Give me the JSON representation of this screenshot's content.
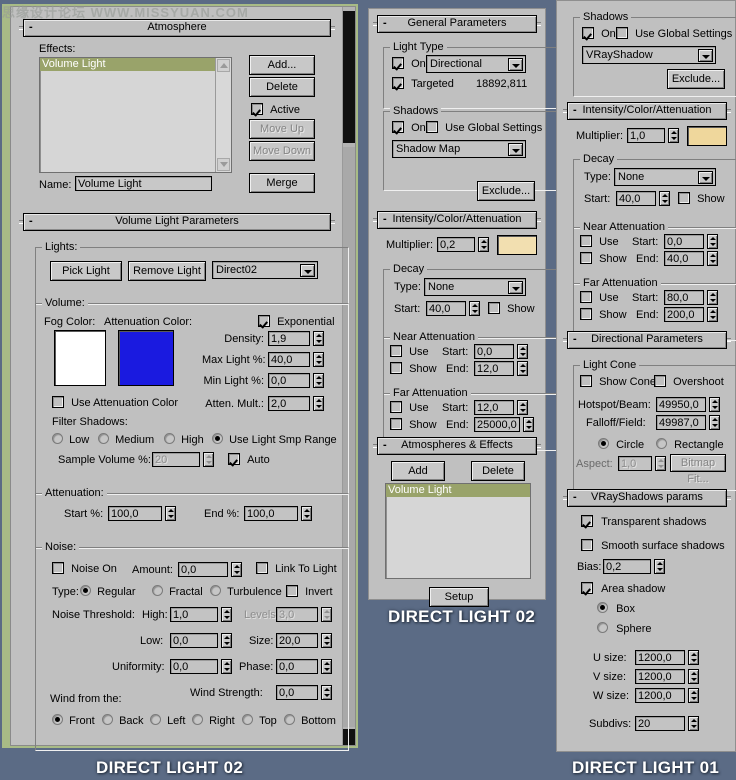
{
  "watermark": "思缘设计论坛  WWW.MISSYUAN.COM",
  "captions": {
    "left": "DIRECT LIGHT 02",
    "middle": "DIRECT LIGHT 02",
    "right": "DIRECT LIGHT 01"
  },
  "colors": {
    "desktop": "#5b6b85",
    "panel": "#c0c0c0",
    "selection": "#99a36a",
    "fog_color": "#ffffff",
    "attenuation_color": "#1a1ae0",
    "light_color_mid": "#f2dfb0",
    "light_color_right": "#efd79c",
    "panel_border_green": "#a8bb86"
  },
  "left_panel": {
    "atmosphere": {
      "title": "Atmosphere",
      "effects_label": "Effects:",
      "effects_items": [
        "Volume Light"
      ],
      "buttons": {
        "add": "Add...",
        "delete": "Delete",
        "move_up": "Move Up",
        "move_down": "Move Down",
        "merge": "Merge"
      },
      "active_label": "Active",
      "active_checked": true,
      "name_label": "Name:",
      "name_value": "Volume Light"
    },
    "volume_light": {
      "title": "Volume Light Parameters",
      "lights_group": "Lights:",
      "pick_light": "Pick Light",
      "remove_light": "Remove Light",
      "light_selected": "Direct02",
      "volume_group": "Volume:",
      "fog_color_label": "Fog Color:",
      "attenuation_color_label": "Attenuation Color:",
      "exponential_label": "Exponential",
      "exponential_checked": true,
      "density_label": "Density:",
      "density_value": "1,9",
      "max_light_label": "Max Light %:",
      "max_light_value": "40,0",
      "min_light_label": "Min Light %:",
      "min_light_value": "0,0",
      "use_attenuation_label": "Use Attenuation Color",
      "use_attenuation_checked": false,
      "atten_mult_label": "Atten. Mult.:",
      "atten_mult_value": "2,0",
      "filter_shadows_label": "Filter Shadows:",
      "filter_options": [
        "Low",
        "Medium",
        "High",
        "Use Light Smp Range"
      ],
      "filter_selected": 3,
      "sample_volume_label": "Sample Volume %:",
      "sample_volume_value": "20",
      "sample_volume_disabled": true,
      "auto_label": "Auto",
      "auto_checked": true,
      "attenuation_group": "Attenuation:",
      "att_start_label": "Start %:",
      "att_start_value": "100,0",
      "att_end_label": "End %:",
      "att_end_value": "100,0",
      "noise_group": "Noise:",
      "noise_on_label": "Noise On",
      "noise_on_checked": false,
      "amount_label": "Amount:",
      "amount_value": "0,0",
      "link_to_light_label": "Link To Light",
      "link_to_light_checked": false,
      "type_label": "Type:",
      "noise_types": [
        "Regular",
        "Fractal",
        "Turbulence"
      ],
      "noise_type_selected": 0,
      "invert_label": "Invert",
      "invert_checked": false,
      "noise_threshold_label": "Noise Threshold:",
      "high_label": "High:",
      "high_value": "1,0",
      "levels_label": "Levels:",
      "levels_value": "3,0",
      "levels_disabled": true,
      "low_label": "Low:",
      "low_value": "0,0",
      "size_label": "Size:",
      "size_value": "20,0",
      "uniformity_label": "Uniformity:",
      "uniformity_value": "0,0",
      "phase_label": "Phase:",
      "phase_value": "0,0",
      "wind_from_label": "Wind from the:",
      "wind_strength_label": "Wind Strength:",
      "wind_strength_value": "0,0",
      "wind_dirs": [
        "Front",
        "Back",
        "Left",
        "Right",
        "Top",
        "Bottom"
      ],
      "wind_dir_selected": 0
    }
  },
  "middle_panel": {
    "general": {
      "title": "General Parameters",
      "light_type_group": "Light Type",
      "on_label": "On",
      "on_checked": true,
      "light_type_value": "Directional",
      "targeted_label": "Targeted",
      "targeted_checked": true,
      "target_distance": "18892,811",
      "shadows_group": "Shadows",
      "shadow_on_label": "On",
      "shadow_on_checked": true,
      "use_global_label": "Use Global Settings",
      "use_global_checked": false,
      "shadow_type_value": "Shadow Map",
      "exclude_label": "Exclude..."
    },
    "intensity": {
      "title": "Intensity/Color/Attenuation",
      "multiplier_label": "Multiplier:",
      "multiplier_value": "0,2",
      "decay_group": "Decay",
      "decay_type_label": "Type:",
      "decay_type_value": "None",
      "decay_start_label": "Start:",
      "decay_start_value": "40,0",
      "decay_show_label": "Show",
      "decay_show_checked": false,
      "near_group": "Near Attenuation",
      "near_use_label": "Use",
      "near_use_checked": false,
      "near_show_label": "Show",
      "near_show_checked": false,
      "near_start_label": "Start:",
      "near_start_value": "0,0",
      "near_end_label": "End:",
      "near_end_value": "12,0",
      "far_group": "Far Attenuation",
      "far_use_label": "Use",
      "far_use_checked": false,
      "far_show_label": "Show",
      "far_show_checked": false,
      "far_start_label": "Start:",
      "far_start_value": "12,0",
      "far_end_label": "End:",
      "far_end_value": "25000,0"
    },
    "atmospheres": {
      "title": "Atmospheres & Effects",
      "add_label": "Add",
      "delete_label": "Delete",
      "items": [
        "Volume Light"
      ],
      "setup_label": "Setup"
    }
  },
  "right_panel": {
    "shadows": {
      "title": "Shadows",
      "on_label": "On",
      "on_checked": true,
      "use_global_label": "Use Global Settings",
      "use_global_checked": false,
      "shadow_type_value": "VRayShadow",
      "exclude_label": "Exclude..."
    },
    "intensity": {
      "title": "Intensity/Color/Attenuation",
      "multiplier_label": "Multiplier:",
      "multiplier_value": "1,0",
      "decay_group": "Decay",
      "decay_type_label": "Type:",
      "decay_type_value": "None",
      "decay_start_label": "Start:",
      "decay_start_value": "40,0",
      "decay_show_label": "Show",
      "decay_show_checked": false,
      "near_group": "Near Attenuation",
      "near_use_label": "Use",
      "near_use_checked": false,
      "near_show_label": "Show",
      "near_show_checked": false,
      "near_start_label": "Start:",
      "near_start_value": "0,0",
      "near_end_label": "End:",
      "near_end_value": "40,0",
      "far_group": "Far Attenuation",
      "far_use_label": "Use",
      "far_use_checked": false,
      "far_show_label": "Show",
      "far_show_checked": false,
      "far_start_label": "Start:",
      "far_start_value": "80,0",
      "far_end_label": "End:",
      "far_end_value": "200,0"
    },
    "directional": {
      "title": "Directional Parameters",
      "light_cone_group": "Light Cone",
      "show_cone_label": "Show Cone",
      "show_cone_checked": false,
      "overshoot_label": "Overshoot",
      "overshoot_checked": false,
      "hotspot_label": "Hotspot/Beam:",
      "hotspot_value": "49950,0",
      "falloff_label": "Falloff/Field:",
      "falloff_value": "49987,0",
      "shape_options": [
        "Circle",
        "Rectangle"
      ],
      "shape_selected": 0,
      "aspect_label": "Aspect:",
      "aspect_value": "1,0",
      "aspect_disabled": true,
      "bitmap_fit_label": "Bitmap Fit..."
    },
    "vrayshadows": {
      "title": "VRayShadows params",
      "transparent_label": "Transparent shadows",
      "transparent_checked": true,
      "smooth_label": "Smooth surface shadows",
      "smooth_checked": false,
      "bias_label": "Bias:",
      "bias_value": "0,2",
      "area_shadow_label": "Area shadow",
      "area_shadow_checked": true,
      "shape_options": [
        "Box",
        "Sphere"
      ],
      "shape_selected": 0,
      "u_size_label": "U size:",
      "u_size_value": "1200,0",
      "v_size_label": "V size:",
      "v_size_value": "1200,0",
      "w_size_label": "W size:",
      "w_size_value": "1200,0",
      "subdivs_label": "Subdivs:",
      "subdivs_value": "20"
    }
  }
}
